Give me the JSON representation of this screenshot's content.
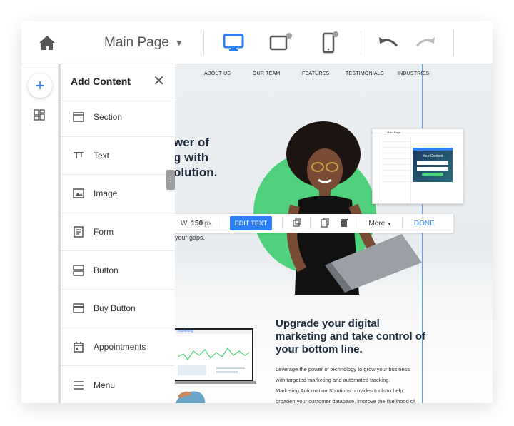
{
  "topbar": {
    "page_name": "Main Page",
    "icons": [
      "home-icon",
      "chevron-down-icon",
      "desktop-view-icon",
      "tablet-view-icon",
      "mobile-view-icon",
      "undo-icon",
      "redo-icon"
    ],
    "accent": "#2d7ff9"
  },
  "rail": {
    "add_symbol": "+",
    "icons": [
      "add-icon",
      "dashboard-grid-icon"
    ]
  },
  "panel": {
    "title": "Add Content",
    "close_symbol": "✕",
    "items": [
      {
        "label": "Section",
        "icon": "section-icon"
      },
      {
        "label": "Text",
        "icon": "text-icon"
      },
      {
        "label": "Image",
        "icon": "image-icon"
      },
      {
        "label": "Form",
        "icon": "form-icon"
      },
      {
        "label": "Button",
        "icon": "button-icon"
      },
      {
        "label": "Buy Button",
        "icon": "buy-button-icon"
      },
      {
        "label": "Appointments",
        "icon": "calendar-icon"
      },
      {
        "label": "Menu",
        "icon": "menu-icon"
      }
    ]
  },
  "canvas": {
    "nav": [
      "ABOUT US",
      "OUR TEAM",
      "FEATURES",
      "TESTIMONIALS",
      "INDUSTRIES"
    ],
    "hero_lines": [
      "wer of",
      "g with",
      "olution."
    ],
    "hero_sub": "your gaps.",
    "green": "#4fd27b",
    "edit_toolbar": {
      "width_label": "W",
      "width_value": "150",
      "width_unit": "px",
      "edit_text": "EDIT TEXT",
      "more": "More",
      "done": "DONE"
    },
    "section_title": "Upgrade your digital marketing and take control of your bottom line.",
    "section_body": [
      "Leverage the power of technology to grow your business",
      "with targeted marketing and automated tracking.",
      "Marketing Automation Solutions provides tools to help",
      "broaden your customer database, improve the likelihood of"
    ],
    "mini_preview": {
      "page_name": "Main Page",
      "card_title": "Your Content"
    },
    "laptop_brand": "marketing"
  }
}
